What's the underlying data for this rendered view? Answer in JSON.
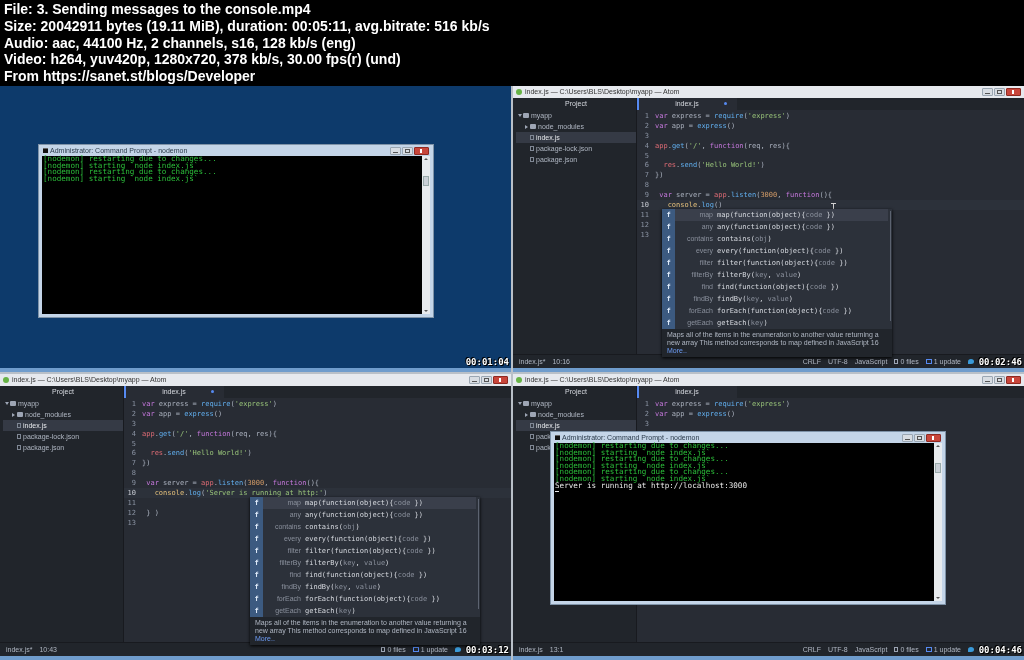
{
  "header": {
    "lines": [
      "File: 3. Sending messages to the console.mp4",
      "Size: 20042911 bytes (19.11 MiB), duration: 00:05:11, avg.bitrate: 516 kb/s",
      "Audio: aac, 44100 Hz, 2 channels, s16, 128 kb/s (eng)",
      "Video: h264, yuv420p, 1280x720, 378 kb/s, 30.00 fps(r) (und)",
      "From https://sanet.st/blogs/Developer"
    ]
  },
  "rows": [
    {
      "frames": [
        {
          "kind": "desktop",
          "timestamp": "00:01:04",
          "console": {
            "title": "Administrator: Command Prompt - nodemon",
            "cursor": false,
            "lines": [
              {
                "text": "[nodemon] restarting due to changes...",
                "kind": "nodemon"
              },
              {
                "text": "[nodemon] starting `node index.js`",
                "kind": "nodemon"
              },
              {
                "text": "[nodemon] restarting due to changes...",
                "kind": "nodemon"
              },
              {
                "text": "[nodemon] starting `node index.js`",
                "kind": "nodemon"
              }
            ]
          }
        },
        {
          "kind": "editor",
          "timestamp": "00:02:46",
          "editor": {
            "title": "index.js — C:\\Users\\BLS\\Desktop\\myapp — Atom",
            "ibeam_cursor": true,
            "tree": {
              "title": "Project",
              "items": [
                {
                  "name": "myapp",
                  "kind": "folder",
                  "expanded": true,
                  "selected": false,
                  "children": [
                    {
                      "name": "node_modules",
                      "kind": "folder",
                      "expanded": false,
                      "selected": false
                    },
                    {
                      "name": "index.js",
                      "kind": "file",
                      "selected": true
                    },
                    {
                      "name": "package-lock.json",
                      "kind": "file",
                      "selected": false
                    },
                    {
                      "name": "package.json",
                      "kind": "file",
                      "selected": false
                    }
                  ]
                }
              ]
            },
            "tab": {
              "label": "index.js",
              "selected": true,
              "modified": true
            },
            "lines": [
              {
                "number": "1",
                "current": false,
                "tokens": [
                  {
                    "text": "var",
                    "kind": "keyword"
                  },
                  {
                    "text": " express = ",
                    "kind": "plain"
                  },
                  {
                    "text": "require",
                    "kind": "function"
                  },
                  {
                    "text": "(",
                    "kind": "plain"
                  },
                  {
                    "text": "'express'",
                    "kind": "string"
                  },
                  {
                    "text": ")",
                    "kind": "plain"
                  }
                ]
              },
              {
                "number": "2",
                "current": false,
                "tokens": [
                  {
                    "text": "var",
                    "kind": "keyword"
                  },
                  {
                    "text": " app = ",
                    "kind": "plain"
                  },
                  {
                    "text": "express",
                    "kind": "function"
                  },
                  {
                    "text": "()",
                    "kind": "plain"
                  }
                ]
              },
              {
                "number": "3",
                "current": false
              },
              {
                "number": "4",
                "current": false,
                "tokens": [
                  {
                    "text": "app",
                    "kind": "variable"
                  },
                  {
                    "text": ".",
                    "kind": "plain"
                  },
                  {
                    "text": "get",
                    "kind": "function"
                  },
                  {
                    "text": "(",
                    "kind": "plain"
                  },
                  {
                    "text": "'/'",
                    "kind": "string"
                  },
                  {
                    "text": ", ",
                    "kind": "plain"
                  },
                  {
                    "text": "function",
                    "kind": "keyword"
                  },
                  {
                    "text": "(req, res){",
                    "kind": "plain"
                  }
                ]
              },
              {
                "number": "5",
                "current": false
              },
              {
                "number": "6",
                "current": false,
                "tokens": [
                  {
                    "text": "  res",
                    "kind": "variable"
                  },
                  {
                    "text": ".",
                    "kind": "plain"
                  },
                  {
                    "text": "send",
                    "kind": "function"
                  },
                  {
                    "text": "(",
                    "kind": "plain"
                  },
                  {
                    "text": "'Hello World!'",
                    "kind": "string"
                  },
                  {
                    "text": ")",
                    "kind": "plain"
                  }
                ]
              },
              {
                "number": "7",
                "current": false,
                "tokens": [
                  {
                    "text": "})",
                    "kind": "plain"
                  }
                ]
              },
              {
                "number": "8",
                "current": false
              },
              {
                "number": "9",
                "current": false,
                "tokens": [
                  {
                    "text": " var",
                    "kind": "keyword"
                  },
                  {
                    "text": " server = ",
                    "kind": "plain"
                  },
                  {
                    "text": "app",
                    "kind": "variable"
                  },
                  {
                    "text": ".",
                    "kind": "plain"
                  },
                  {
                    "text": "listen",
                    "kind": "function"
                  },
                  {
                    "text": "(",
                    "kind": "plain"
                  },
                  {
                    "text": "3000",
                    "kind": "number"
                  },
                  {
                    "text": ", ",
                    "kind": "plain"
                  },
                  {
                    "text": "function",
                    "kind": "keyword"
                  },
                  {
                    "text": "(){",
                    "kind": "plain"
                  }
                ]
              },
              {
                "number": "10",
                "current": true,
                "tokens": [
                  {
                    "text": "   console",
                    "kind": "support"
                  },
                  {
                    "text": ".",
                    "kind": "plain"
                  },
                  {
                    "text": "log",
                    "kind": "function"
                  },
                  {
                    "text": "()",
                    "kind": "plain"
                  }
                ]
              },
              {
                "number": "11",
                "current": false
              },
              {
                "number": "12",
                "current": false
              },
              {
                "number": "13",
                "current": false
              }
            ],
            "autocomplete": {
              "items": [
                {
                  "type": "f",
                  "label": "map",
                  "signature": [
                    "map(function(object){",
                    "code",
                    " })"
                  ],
                  "selected": true
                },
                {
                  "type": "f",
                  "label": "any",
                  "signature": [
                    "any(function(object){",
                    "code",
                    " })"
                  ],
                  "selected": false
                },
                {
                  "type": "f",
                  "label": "contains",
                  "signature": [
                    "contains(",
                    "obj",
                    ")"
                  ],
                  "selected": false
                },
                {
                  "type": "f",
                  "label": "every",
                  "signature": [
                    "every(function(object){",
                    "code",
                    " })"
                  ],
                  "selected": false
                },
                {
                  "type": "f",
                  "label": "filter",
                  "signature": [
                    "filter(function(object){",
                    "code",
                    " })"
                  ],
                  "selected": false
                },
                {
                  "type": "f",
                  "label": "filterBy",
                  "signature": [
                    "filterBy(",
                    "key",
                    ", ",
                    "value",
                    ")"
                  ],
                  "selected": false
                },
                {
                  "type": "f",
                  "label": "find",
                  "signature": [
                    "find(function(object){",
                    "code",
                    " })"
                  ],
                  "selected": false
                },
                {
                  "type": "f",
                  "label": "findBy",
                  "signature": [
                    "findBy(",
                    "key",
                    ", ",
                    "value",
                    ")"
                  ],
                  "selected": false
                },
                {
                  "type": "f",
                  "label": "forEach",
                  "signature": [
                    "forEach(function(object){",
                    "code",
                    " })"
                  ],
                  "selected": false
                },
                {
                  "type": "f",
                  "label": "getEach",
                  "signature": [
                    "getEach(",
                    "key",
                    ")"
                  ],
                  "selected": false
                }
              ],
              "description": "Maps all of the items in the enumeration to another value returning a new array This method corresponds to map defined in JavaScript 16",
              "more": "More.."
            },
            "status": {
              "left": [
                "index.js*",
                "10:16"
              ],
              "right": [
                {
                  "text": "CRLF",
                  "kind": "plain"
                },
                {
                  "text": "UTF-8",
                  "kind": "plain"
                },
                {
                  "text": "JavaScript",
                  "kind": "plain"
                },
                {
                  "text": "0 files",
                  "kind": "files"
                },
                {
                  "text": "1 update",
                  "kind": "updates"
                }
              ]
            }
          }
        }
      ]
    },
    {
      "frames": [
        {
          "kind": "editor",
          "timestamp": "00:03:12",
          "editor": {
            "title": "index.js — C:\\Users\\BLS\\Desktop\\myapp — Atom",
            "ibeam_cursor": false,
            "tree": {
              "title": "Project",
              "items": [
                {
                  "name": "myapp",
                  "kind": "folder",
                  "expanded": true,
                  "selected": false,
                  "children": [
                    {
                      "name": "node_modules",
                      "kind": "folder",
                      "expanded": false,
                      "selected": false
                    },
                    {
                      "name": "index.js",
                      "kind": "file",
                      "selected": true
                    },
                    {
                      "name": "package-lock.json",
                      "kind": "file",
                      "selected": false
                    },
                    {
                      "name": "package.json",
                      "kind": "file",
                      "selected": false
                    }
                  ]
                }
              ]
            },
            "tab": {
              "label": "index.js",
              "selected": true,
              "modified": true
            },
            "lines": [
              {
                "number": "1",
                "current": false,
                "tokens": [
                  {
                    "text": "var",
                    "kind": "keyword"
                  },
                  {
                    "text": " express = ",
                    "kind": "plain"
                  },
                  {
                    "text": "require",
                    "kind": "function"
                  },
                  {
                    "text": "(",
                    "kind": "plain"
                  },
                  {
                    "text": "'express'",
                    "kind": "string"
                  },
                  {
                    "text": ")",
                    "kind": "plain"
                  }
                ]
              },
              {
                "number": "2",
                "current": false,
                "tokens": [
                  {
                    "text": "var",
                    "kind": "keyword"
                  },
                  {
                    "text": " app = ",
                    "kind": "plain"
                  },
                  {
                    "text": "express",
                    "kind": "function"
                  },
                  {
                    "text": "()",
                    "kind": "plain"
                  }
                ]
              },
              {
                "number": "3",
                "current": false
              },
              {
                "number": "4",
                "current": false,
                "tokens": [
                  {
                    "text": "app",
                    "kind": "variable"
                  },
                  {
                    "text": ".",
                    "kind": "plain"
                  },
                  {
                    "text": "get",
                    "kind": "function"
                  },
                  {
                    "text": "(",
                    "kind": "plain"
                  },
                  {
                    "text": "'/'",
                    "kind": "string"
                  },
                  {
                    "text": ", ",
                    "kind": "plain"
                  },
                  {
                    "text": "function",
                    "kind": "keyword"
                  },
                  {
                    "text": "(req, res){",
                    "kind": "plain"
                  }
                ]
              },
              {
                "number": "5",
                "current": false
              },
              {
                "number": "6",
                "current": false,
                "tokens": [
                  {
                    "text": "  res",
                    "kind": "variable"
                  },
                  {
                    "text": ".",
                    "kind": "plain"
                  },
                  {
                    "text": "send",
                    "kind": "function"
                  },
                  {
                    "text": "(",
                    "kind": "plain"
                  },
                  {
                    "text": "'Hello World!'",
                    "kind": "string"
                  },
                  {
                    "text": ")",
                    "kind": "plain"
                  }
                ]
              },
              {
                "number": "7",
                "current": false,
                "tokens": [
                  {
                    "text": "})",
                    "kind": "plain"
                  }
                ]
              },
              {
                "number": "8",
                "current": false
              },
              {
                "number": "9",
                "current": false,
                "tokens": [
                  {
                    "text": " var",
                    "kind": "keyword"
                  },
                  {
                    "text": " server = ",
                    "kind": "plain"
                  },
                  {
                    "text": "app",
                    "kind": "variable"
                  },
                  {
                    "text": ".",
                    "kind": "plain"
                  },
                  {
                    "text": "listen",
                    "kind": "function"
                  },
                  {
                    "text": "(",
                    "kind": "plain"
                  },
                  {
                    "text": "3000",
                    "kind": "number"
                  },
                  {
                    "text": ", ",
                    "kind": "plain"
                  },
                  {
                    "text": "function",
                    "kind": "keyword"
                  },
                  {
                    "text": "(){",
                    "kind": "plain"
                  }
                ]
              },
              {
                "number": "10",
                "current": true,
                "tokens": [
                  {
                    "text": "   console",
                    "kind": "support"
                  },
                  {
                    "text": ".",
                    "kind": "plain"
                  },
                  {
                    "text": "log",
                    "kind": "function"
                  },
                  {
                    "text": "(",
                    "kind": "plain"
                  },
                  {
                    "text": "'Server is running at http:'",
                    "kind": "string"
                  },
                  {
                    "text": ")",
                    "kind": "plain"
                  }
                ]
              },
              {
                "number": "11",
                "current": false
              },
              {
                "number": "12",
                "current": false,
                "tokens": [
                  {
                    "text": " } )",
                    "kind": "plain"
                  }
                ]
              },
              {
                "number": "13",
                "current": false
              }
            ],
            "autocomplete": {
              "items": [
                {
                  "type": "f",
                  "label": "map",
                  "signature": [
                    "map(function(object){",
                    "code",
                    " })"
                  ],
                  "selected": true
                },
                {
                  "type": "f",
                  "label": "any",
                  "signature": [
                    "any(function(object){",
                    "code",
                    " })"
                  ],
                  "selected": false
                },
                {
                  "type": "f",
                  "label": "contains",
                  "signature": [
                    "contains(",
                    "obj",
                    ")"
                  ],
                  "selected": false
                },
                {
                  "type": "f",
                  "label": "every",
                  "signature": [
                    "every(function(object){",
                    "code",
                    " })"
                  ],
                  "selected": false
                },
                {
                  "type": "f",
                  "label": "filter",
                  "signature": [
                    "filter(function(object){",
                    "code",
                    " })"
                  ],
                  "selected": false
                },
                {
                  "type": "f",
                  "label": "filterBy",
                  "signature": [
                    "filterBy(",
                    "key",
                    ", ",
                    "value",
                    ")"
                  ],
                  "selected": false
                },
                {
                  "type": "f",
                  "label": "find",
                  "signature": [
                    "find(function(object){",
                    "code",
                    " })"
                  ],
                  "selected": false
                },
                {
                  "type": "f",
                  "label": "findBy",
                  "signature": [
                    "findBy(",
                    "key",
                    ", ",
                    "value",
                    ")"
                  ],
                  "selected": false
                },
                {
                  "type": "f",
                  "label": "forEach",
                  "signature": [
                    "forEach(function(object){",
                    "code",
                    " })"
                  ],
                  "selected": false
                },
                {
                  "type": "f",
                  "label": "getEach",
                  "signature": [
                    "getEach(",
                    "key",
                    ")"
                  ],
                  "selected": false
                }
              ],
              "description": "Maps all of the items in the enumeration to another value returning a new array This method corresponds to map defined in JavaScript 16",
              "more": "More.."
            },
            "status": {
              "left": [
                "index.js*",
                "10:43"
              ],
              "right": [
                {
                  "text": "0 files",
                  "kind": "files"
                },
                {
                  "text": "1 update",
                  "kind": "updates"
                }
              ]
            }
          }
        },
        {
          "kind": "editor",
          "timestamp": "00:04:46",
          "editor": {
            "title": "index.js — C:\\Users\\BLS\\Desktop\\myapp — Atom",
            "ibeam_cursor": false,
            "tree": {
              "title": "Project",
              "items": [
                {
                  "name": "myapp",
                  "kind": "folder",
                  "expanded": true,
                  "selected": false,
                  "children": [
                    {
                      "name": "node_modules",
                      "kind": "folder",
                      "expanded": false,
                      "selected": false
                    },
                    {
                      "name": "index.js",
                      "kind": "file",
                      "selected": true
                    },
                    {
                      "name": "pack",
                      "kind": "file",
                      "selected": false
                    },
                    {
                      "name": "pack",
                      "kind": "file",
                      "selected": false
                    }
                  ]
                }
              ]
            },
            "tab": {
              "label": "index.js",
              "selected": true,
              "modified": false
            },
            "lines": [
              {
                "number": "1",
                "current": false,
                "tokens": [
                  {
                    "text": "var",
                    "kind": "keyword"
                  },
                  {
                    "text": " express = ",
                    "kind": "plain"
                  },
                  {
                    "text": "require",
                    "kind": "function"
                  },
                  {
                    "text": "(",
                    "kind": "plain"
                  },
                  {
                    "text": "'express'",
                    "kind": "string"
                  },
                  {
                    "text": ")",
                    "kind": "plain"
                  }
                ]
              },
              {
                "number": "2",
                "current": false,
                "tokens": [
                  {
                    "text": "var",
                    "kind": "keyword"
                  },
                  {
                    "text": " app = ",
                    "kind": "plain"
                  },
                  {
                    "text": "express",
                    "kind": "function"
                  },
                  {
                    "text": "()",
                    "kind": "plain"
                  }
                ]
              },
              {
                "number": "3",
                "current": false
              }
            ],
            "status": {
              "left": [
                "index.js",
                "13:1"
              ],
              "right": [
                {
                  "text": "CRLF",
                  "kind": "plain"
                },
                {
                  "text": "UTF-8",
                  "kind": "plain"
                },
                {
                  "text": "JavaScript",
                  "kind": "plain"
                },
                {
                  "text": "0 files",
                  "kind": "files"
                },
                {
                  "text": "1 update",
                  "kind": "updates"
                }
              ]
            }
          },
          "console": {
            "title": "Administrator: Command Prompt - nodemon",
            "cursor": true,
            "lines": [
              {
                "text": "[nodemon] restarting due to changes...",
                "kind": "nodemon"
              },
              {
                "text": "[nodemon] starting `node index.js`",
                "kind": "nodemon"
              },
              {
                "text": "[nodemon] restarting due to changes...",
                "kind": "nodemon"
              },
              {
                "text": "[nodemon] starting `node index.js`",
                "kind": "nodemon"
              },
              {
                "text": "[nodemon] restarting due to changes...",
                "kind": "nodemon"
              },
              {
                "text": "[nodemon] starting `node index.js`",
                "kind": "nodemon"
              },
              {
                "text": "Server is running at http://localhost:3000",
                "kind": "output"
              }
            ]
          }
        }
      ]
    }
  ]
}
